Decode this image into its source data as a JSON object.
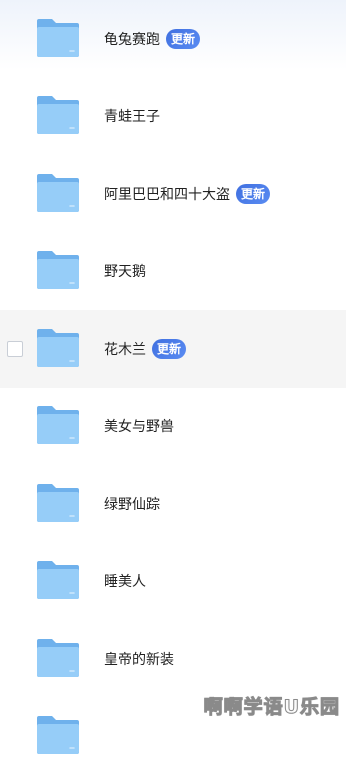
{
  "colors": {
    "badge": "#4a7ae8",
    "folder_back": "#6fb1ec",
    "folder_front": "#96cdf8",
    "hover_row": "#f5f5f5",
    "text": "#222222"
  },
  "folders": [
    {
      "name": "龟兔赛跑",
      "badge": "更新",
      "icon": "folder-icon"
    },
    {
      "name": "青蛙王子",
      "badge": "",
      "icon": "folder-icon"
    },
    {
      "name": "阿里巴巴和四十大盗",
      "badge": "更新",
      "icon": "folder-icon"
    },
    {
      "name": "野天鹅",
      "badge": "",
      "icon": "folder-icon"
    },
    {
      "name": "花木兰",
      "badge": "更新",
      "icon": "folder-icon",
      "hovered": true
    },
    {
      "name": "美女与野兽",
      "badge": "",
      "icon": "folder-icon"
    },
    {
      "name": "绿野仙踪",
      "badge": "",
      "icon": "folder-icon"
    },
    {
      "name": "睡美人",
      "badge": "",
      "icon": "folder-icon"
    },
    {
      "name": "皇帝的新装",
      "badge": "",
      "icon": "folder-icon"
    },
    {
      "name": "",
      "badge": "",
      "icon": "folder-icon"
    }
  ],
  "watermark": {
    "text": "啊啊学语U乐园"
  }
}
